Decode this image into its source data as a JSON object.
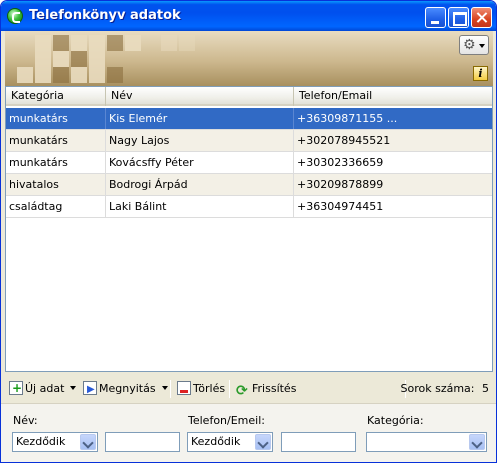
{
  "window": {
    "title": "Telefonkönyv adatok"
  },
  "banner": {
    "settings_icon": "gear-icon",
    "info_label": "i"
  },
  "table": {
    "columns": [
      "Kategória",
      "Név",
      "Telefon/Email"
    ],
    "rows": [
      [
        "munkatárs",
        "Kis Elemér",
        "+36309871155 ..."
      ],
      [
        "munkatárs",
        "Nagy Lajos",
        "+302078945521"
      ],
      [
        "munkatárs",
        "Kovácsffy Péter",
        "+30302336659"
      ],
      [
        "hivatalos",
        "Bodrogi Árpád",
        "+30209878899"
      ],
      [
        "családtag",
        "Laki Bálint",
        "+36304974451"
      ]
    ],
    "selected_row": 0
  },
  "toolbar": {
    "new_label": "Új adat",
    "open_label": "Megnyitás",
    "delete_label": "Törlés",
    "refresh_label": "Frissítés",
    "rowcount_label": "Sorok száma:",
    "rowcount_value": "5"
  },
  "filters": {
    "name_label": "Név:",
    "name_mode": "Kezdődik",
    "name_value": "",
    "phone_label": "Telefon/Emeil:",
    "phone_mode": "Kezdődik",
    "phone_value": "",
    "category_label": "Kategória:",
    "category_value": ""
  },
  "colors": {
    "selection": "#316ac5",
    "titlebar": "#0054e3"
  }
}
